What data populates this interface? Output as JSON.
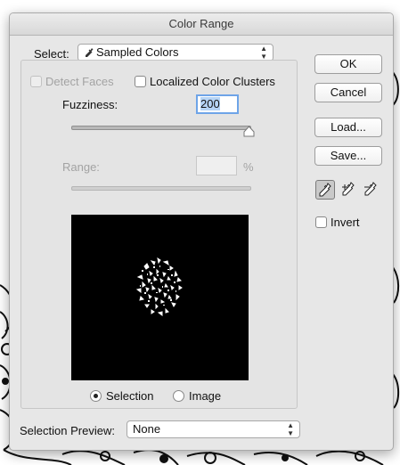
{
  "dialog": {
    "title": "Color Range"
  },
  "select": {
    "label": "Select:",
    "value": "Sampled Colors",
    "value_icon": "eyedropper-icon"
  },
  "options": {
    "detect_faces": {
      "label": "Detect Faces",
      "checked": false,
      "enabled": false
    },
    "localized_color_clusters": {
      "label": "Localized Color Clusters",
      "checked": false,
      "enabled": true
    }
  },
  "fuzziness": {
    "label": "Fuzziness:",
    "value": "200",
    "slider_fraction": 1.0
  },
  "range": {
    "label": "Range:",
    "value": "",
    "unit": "%",
    "enabled": false
  },
  "preview_mode": {
    "options": [
      {
        "label": "Selection",
        "selected": true
      },
      {
        "label": "Image",
        "selected": false
      }
    ]
  },
  "selection_preview": {
    "label": "Selection Preview:",
    "value": "None"
  },
  "buttons": {
    "ok": "OK",
    "cancel": "Cancel",
    "load": "Load...",
    "save": "Save..."
  },
  "tools": [
    "eyedropper-icon",
    "add-to-sample-icon",
    "subtract-from-sample-icon"
  ],
  "invert": {
    "label": "Invert",
    "checked": false
  }
}
